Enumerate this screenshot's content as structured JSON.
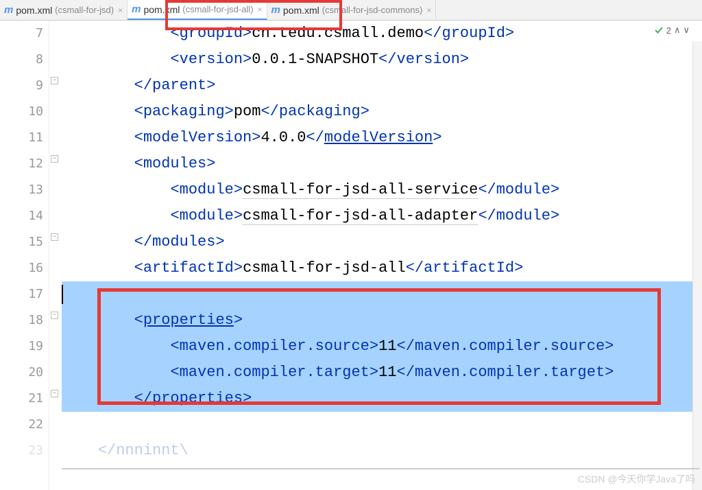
{
  "tabs": [
    {
      "icon": "m",
      "name": "pom.xml",
      "qualifier": "(csmall-for-jsd)",
      "active": false
    },
    {
      "icon": "m",
      "name": "pom.xml",
      "qualifier": "(csmall-for-jsd-all)",
      "active": true
    },
    {
      "icon": "m",
      "name": "pom.xml",
      "qualifier": "(csmall-for-jsd-commons)",
      "active": false
    }
  ],
  "inspection": {
    "count": "2"
  },
  "lines": {
    "l7": {
      "num": "7",
      "ind": "            ",
      "open": "<groupId>",
      "val": "cn.tedu.csmall.demo",
      "close": "</groupId>"
    },
    "l8": {
      "num": "8",
      "ind": "            ",
      "open": "<version>",
      "val": "0.0.1-SNAPSHOT",
      "close": "</version>"
    },
    "l9": {
      "num": "9",
      "ind": "        ",
      "open": "</parent>"
    },
    "l10": {
      "num": "10",
      "ind": "        ",
      "open": "<packaging>",
      "val": "pom",
      "close": "</packaging>"
    },
    "l11": {
      "num": "11",
      "ind": "        ",
      "open": "<modelVersion>",
      "val": "4.0.0",
      "close_pre": "</",
      "close_name": "modelVersion",
      "close_post": ">"
    },
    "l12": {
      "num": "12",
      "ind": "        ",
      "open": "<modules>"
    },
    "l13": {
      "num": "13",
      "ind": "            ",
      "open": "<module>",
      "val": "csmall-for-jsd-all-service",
      "close": "</module>"
    },
    "l14": {
      "num": "14",
      "ind": "            ",
      "open": "<module>",
      "val": "csmall-for-jsd-all-adapter",
      "close": "</module>"
    },
    "l15": {
      "num": "15",
      "ind": "        ",
      "open": "</modules>"
    },
    "l16": {
      "num": "16",
      "ind": "        ",
      "open": "<artifactId>",
      "val": "csmall-for-jsd-all",
      "close": "</artifactId>"
    },
    "l17": {
      "num": "17"
    },
    "l18": {
      "num": "18",
      "ind": "        ",
      "open_pre": "<",
      "open_name": "properties",
      "open_post": ">"
    },
    "l19": {
      "num": "19",
      "ind": "            ",
      "open": "<maven.compiler.source>",
      "val": "11",
      "close": "</maven.compiler.source>"
    },
    "l20": {
      "num": "20",
      "ind": "            ",
      "open": "<maven.compiler.target>",
      "val": "11",
      "close": "</maven.compiler.target>"
    },
    "l21": {
      "num": "21",
      "ind": "        ",
      "close_pre": "</",
      "close_name": "properties",
      "close_post": ">"
    },
    "l22": {
      "num": "22"
    },
    "l23": {
      "num": "23",
      "ind": "    ",
      "partial": "</nnninnt\\"
    }
  },
  "watermark": "CSDN @今天你学Java了吗"
}
